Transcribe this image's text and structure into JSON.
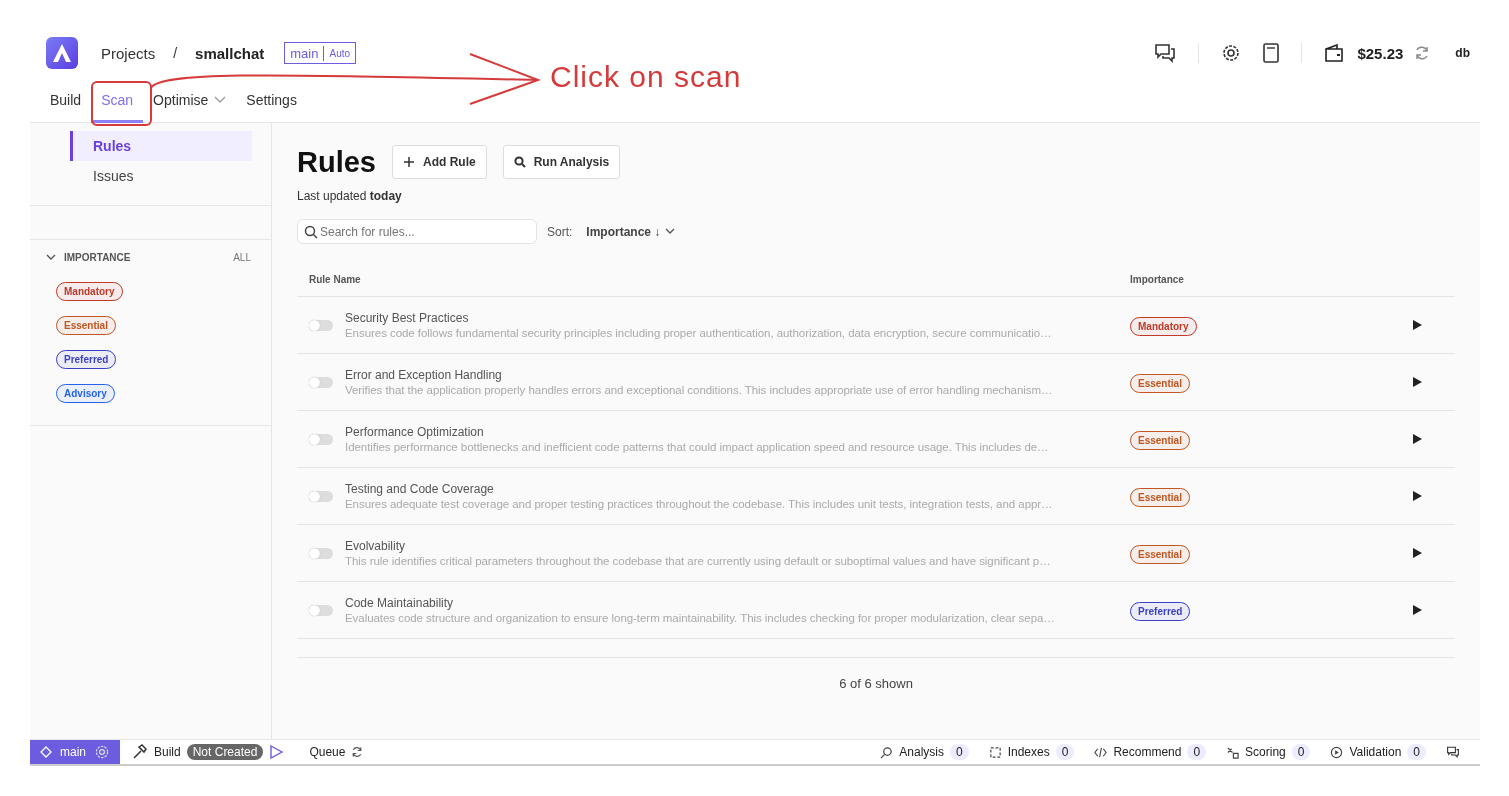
{
  "header": {
    "breadcrumb": "Projects",
    "separator": "/",
    "project": "smallchat",
    "branch": "main",
    "mode": "Auto",
    "balance": "$25.23",
    "user": "db"
  },
  "tabs": [
    {
      "label": "Build",
      "selected": false,
      "dropdown": false
    },
    {
      "label": "Scan",
      "selected": true,
      "dropdown": false
    },
    {
      "label": "Optimise",
      "selected": false,
      "dropdown": true
    },
    {
      "label": "Settings",
      "selected": false,
      "dropdown": false
    }
  ],
  "sidebar": {
    "items": [
      {
        "label": "Rules",
        "selected": true
      },
      {
        "label": "Issues",
        "selected": false
      }
    ],
    "filter": {
      "title": "IMPORTANCE",
      "expanded": true,
      "all": "ALL",
      "tags": [
        {
          "label": "Mandatory",
          "color": "#c0392b"
        },
        {
          "label": "Essential",
          "color": "#c05621"
        },
        {
          "label": "Preferred",
          "color": "#3b3fc4"
        },
        {
          "label": "Advisory",
          "color": "#2563eb"
        }
      ]
    }
  },
  "main": {
    "title": "Rules",
    "buttons": [
      "Add Rule",
      "Run Analysis"
    ],
    "updated": "Last updated **today**",
    "search": {
      "placeholder": "Search for rules..."
    },
    "sort_label": "Sort:",
    "sort_value": "Importance ↓",
    "table": {
      "columns": [
        "Rule Name",
        "Importance"
      ],
      "rows": [
        {
          "name": "Security Best Practices",
          "description": "Ensures code follows fundamental security principles including proper authentication, authorization, data encryption, secure communicatio…",
          "on": false,
          "importance": "Mandatory",
          "color": "#c0392b"
        },
        {
          "name": "Error and Exception Handling",
          "description": "Verifies that the application properly handles errors and exceptional conditions. This includes appropriate use of error handling mechanism…",
          "on": false,
          "importance": "Essential",
          "color": "#c05621"
        },
        {
          "name": "Performance Optimization",
          "description": "Identifies performance bottlenecks and inefficient code patterns that could impact application speed and resource usage. This includes de…",
          "on": false,
          "importance": "Essential",
          "color": "#c05621"
        },
        {
          "name": "Testing and Code Coverage",
          "description": "Ensures adequate test coverage and proper testing practices throughout the codebase. This includes unit tests, integration tests, and appr…",
          "on": false,
          "importance": "Essential",
          "color": "#c05621"
        },
        {
          "name": "Evolvability",
          "description": "This rule identifies critical parameters throughout the codebase that are currently using default or suboptimal values and have significant p…",
          "on": false,
          "importance": "Essential",
          "color": "#c05621"
        },
        {
          "name": "Code Maintainability",
          "description": "Evaluates code structure and organization to ensure long-term maintainability. This includes checking for proper modularization, clear sepa…",
          "on": false,
          "importance": "Preferred",
          "color": "#3b3fc4"
        }
      ],
      "footer": "6 of 6 shown"
    }
  },
  "status_bar": {
    "branch": "main",
    "build": "Build",
    "build_status": "Not Created",
    "queue": "Queue",
    "counters": [
      {
        "kind": "analysis",
        "label": "Analysis",
        "count": "0"
      },
      {
        "kind": "indexes",
        "label": "Indexes",
        "count": "0"
      },
      {
        "kind": "recommend",
        "label": "Recommend",
        "count": "0"
      },
      {
        "kind": "scoring",
        "label": "Scoring",
        "count": "0"
      },
      {
        "kind": "validation",
        "label": "Validation",
        "count": "0"
      }
    ]
  },
  "annotation": {
    "text": "Click on scan"
  }
}
